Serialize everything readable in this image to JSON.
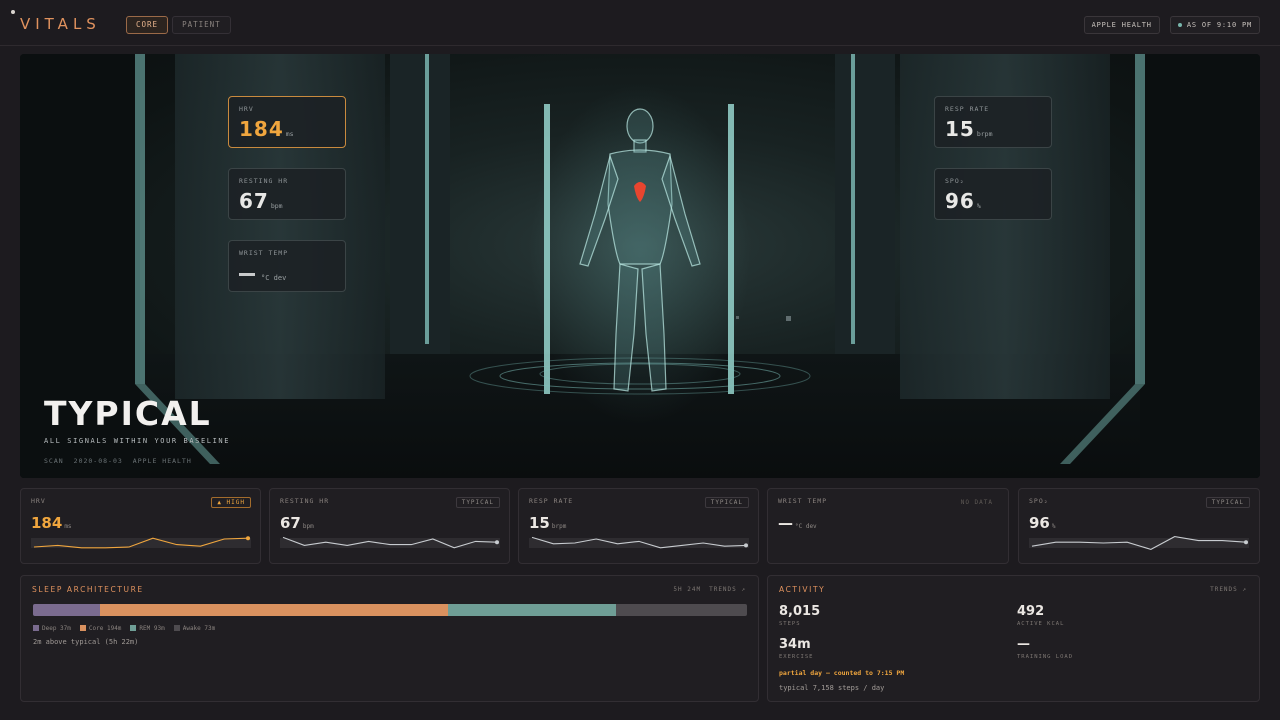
{
  "header": {
    "logo": "VITALS",
    "tabs": [
      {
        "label": "CORE",
        "active": true
      },
      {
        "label": "PATIENT",
        "active": false
      }
    ],
    "source_chip": "APPLE HEALTH",
    "as_of": "AS OF 9:10 PM"
  },
  "hero": {
    "cards_left": [
      {
        "label": "HRV",
        "value": "184",
        "unit": "ms"
      },
      {
        "label": "RESTING HR",
        "value": "67",
        "unit": "bpm"
      },
      {
        "label": "WRIST TEMP",
        "value": "",
        "unit": "°C dev"
      }
    ],
    "cards_right": [
      {
        "label": "RESP RATE",
        "value": "15",
        "unit": "brpm"
      },
      {
        "label": "SPO₂",
        "value": "96",
        "unit": "%"
      }
    ],
    "status": "TYPICAL",
    "status_sub": "ALL SIGNALS WITHIN YOUR BASELINE",
    "meta": [
      "SCAN",
      "2020-08-03",
      "APPLE HEALTH"
    ]
  },
  "metrics": [
    {
      "label": "HRV",
      "value": "184",
      "unit": "ms",
      "badge": "▲ HIGH",
      "spark": [
        0.25,
        0.35,
        0.2,
        0.2,
        0.25,
        0.8,
        0.4,
        0.3,
        0.75,
        0.8
      ]
    },
    {
      "label": "RESTING HR",
      "value": "67",
      "unit": "bpm",
      "badge": "TYPICAL",
      "spark": [
        0.85,
        0.35,
        0.55,
        0.35,
        0.6,
        0.4,
        0.4,
        0.75,
        0.2,
        0.6,
        0.55
      ]
    },
    {
      "label": "RESP RATE",
      "value": "15",
      "unit": "brpm",
      "badge": "TYPICAL",
      "spark": [
        0.85,
        0.45,
        0.5,
        0.75,
        0.45,
        0.6,
        0.2,
        0.35,
        0.5,
        0.3,
        0.35
      ]
    },
    {
      "label": "WRIST TEMP",
      "value": "—",
      "unit": "°C dev",
      "badge": "NO DATA",
      "spark": []
    },
    {
      "label": "SPO₂",
      "value": "96",
      "unit": "%",
      "badge": "TYPICAL",
      "spark": [
        0.3,
        0.55,
        0.55,
        0.5,
        0.55,
        0.1,
        0.9,
        0.65,
        0.65,
        0.55
      ]
    }
  ],
  "sleep": {
    "title": "SLEEP ARCHITECTURE",
    "total": "5H 24M",
    "trends": "TRENDS ↗",
    "stages": [
      {
        "name": "Deep",
        "label": "Deep 37m",
        "minutes": 37,
        "color": "#7a6b8f"
      },
      {
        "name": "Core",
        "label": "Core 194m",
        "minutes": 194,
        "color": "#d9915f"
      },
      {
        "name": "REM",
        "label": "REM 93m",
        "minutes": 93,
        "color": "#6f9e96"
      },
      {
        "name": "Awake",
        "label": "Awake 73m",
        "minutes": 73,
        "color": "#4e4b4f"
      }
    ],
    "note": "2m above typical (5h 22m)"
  },
  "activity": {
    "title": "ACTIVITY",
    "trends": "TRENDS ↗",
    "items": [
      {
        "value": "8,015",
        "caption": "STEPS"
      },
      {
        "value": "492",
        "caption": "ACTIVE KCAL"
      },
      {
        "value": "34m",
        "caption": "EXERCISE"
      },
      {
        "value": "—",
        "caption": "TRAINING LOAD"
      }
    ],
    "partial_note": "partial day — counted to 7:15 PM",
    "typical_note": "typical 7,158 steps / day"
  },
  "colors": {
    "accent": "#e0925e",
    "high": "#f0a63e",
    "teal": "#79b6ac"
  }
}
